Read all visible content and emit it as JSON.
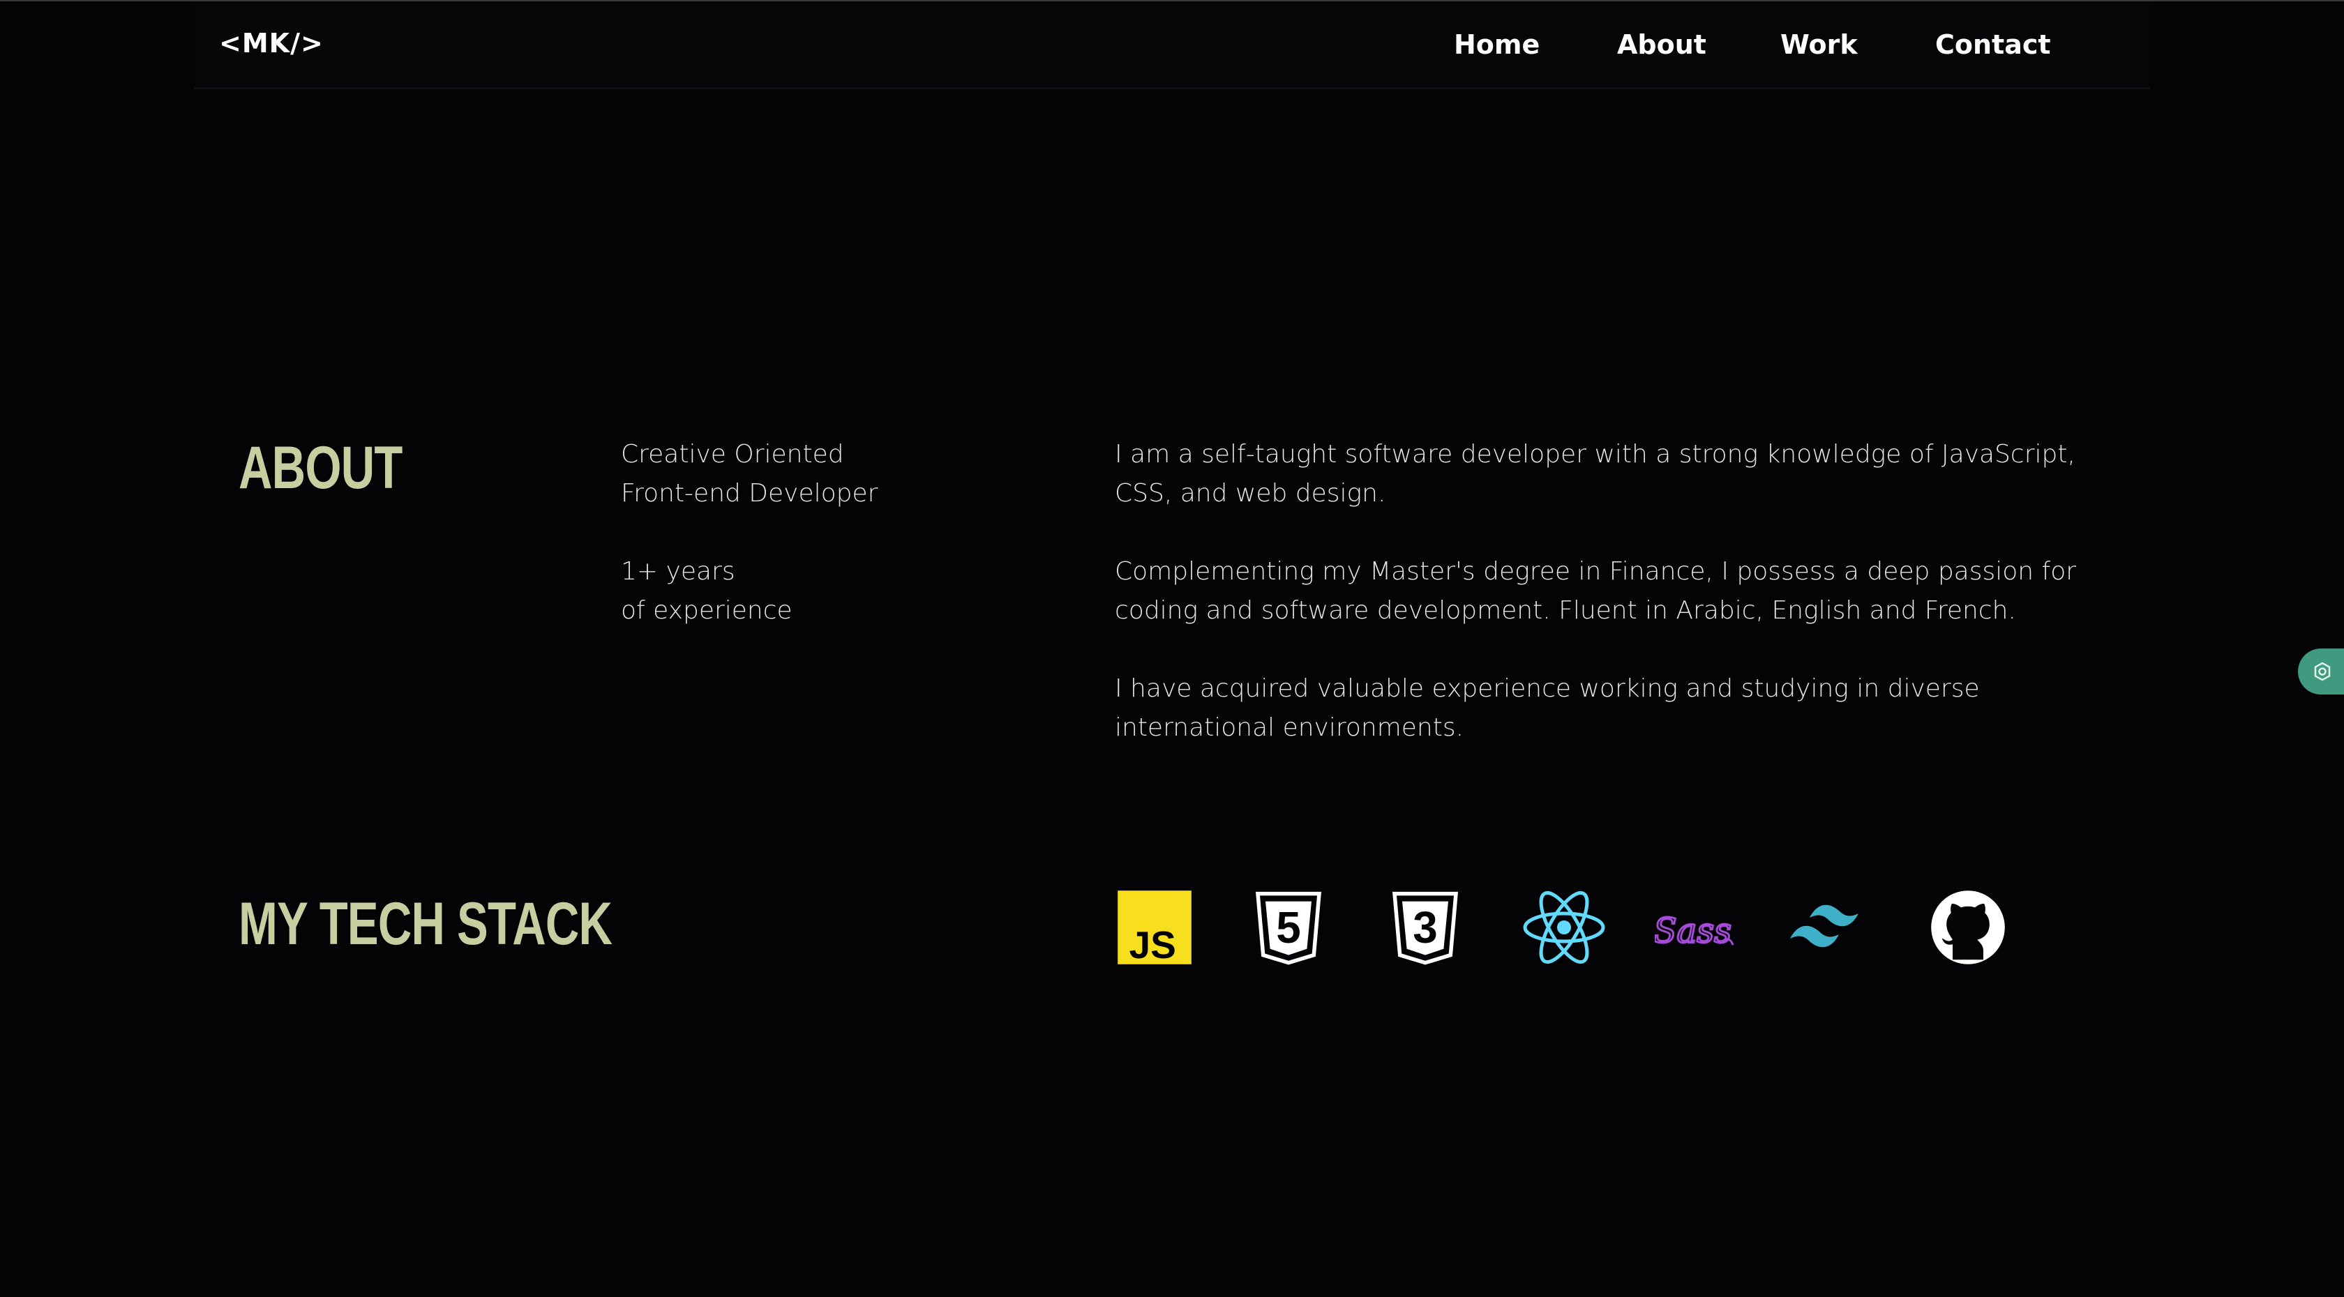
{
  "header": {
    "logo": "<MK/>",
    "nav": [
      {
        "label": "Home"
      },
      {
        "label": "About"
      },
      {
        "label": "Work"
      },
      {
        "label": "Contact"
      }
    ]
  },
  "about": {
    "heading": "ABOUT",
    "role_line1": "Creative Oriented",
    "role_line2": "Front-end Developer",
    "exp_line1": "1+ years",
    "exp_line2": "of experience",
    "p1_line1": "I am a self-taught software developer with a strong knowledge of JavaScript,",
    "p1_line2": "CSS, and web design.",
    "p2_line1": "Complementing my Master's degree in Finance, I possess a deep passion for",
    "p2_line2": "coding and software development. Fluent in Arabic, English and French.",
    "p3_line1": "I have acquired valuable experience working and studying in diverse",
    "p3_line2": "international environments."
  },
  "tech_stack": {
    "heading": "MY TECH STACK",
    "icons": [
      {
        "name": "javascript-icon",
        "text": "JS",
        "color": "#f7df1e"
      },
      {
        "name": "html5-icon",
        "text": "5",
        "color": "#ffffff"
      },
      {
        "name": "css3-icon",
        "text": "3",
        "color": "#ffffff"
      },
      {
        "name": "react-icon",
        "color": "#61dafb"
      },
      {
        "name": "sass-icon",
        "text": "Sass",
        "color": "#a44bd8"
      },
      {
        "name": "tailwind-icon",
        "color": "#3eb0c7"
      },
      {
        "name": "github-icon",
        "color": "#ffffff"
      }
    ]
  },
  "colors": {
    "background": "#040406",
    "heading": "#c5cfa0",
    "text": "#e4e4e6",
    "float_button": "#3f9a80"
  },
  "float_button": {
    "icon": "gear-icon"
  }
}
